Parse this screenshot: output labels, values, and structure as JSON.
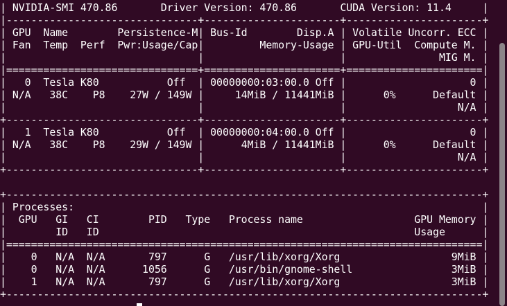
{
  "terminal": {
    "background": "#300a24",
    "foreground": "#ffffff",
    "lines": [
      "| NVIDIA-SMI 470.86       Driver Version: 470.86       CUDA Version: 11.4     |",
      "|-------------------------------+----------------------+----------------------+",
      "| GPU  Name        Persistence-M| Bus-Id        Disp.A | Volatile Uncorr. ECC |",
      "| Fan  Temp  Perf  Pwr:Usage/Cap|         Memory-Usage | GPU-Util  Compute M. |",
      "|                               |                      |               MIG M. |",
      "|===============================+======================+======================|",
      "|   0  Tesla K80           Off  | 00000000:03:00.0 Off |                    0 |",
      "| N/A   38C    P8    27W / 149W |     14MiB / 11441MiB |      0%      Default |",
      "|                               |                      |                  N/A |",
      "+-------------------------------+----------------------+----------------------+",
      "|   1  Tesla K80           Off  | 00000000:04:00.0 Off |                    0 |",
      "| N/A   38C    P8    29W / 149W |      4MiB / 11441MiB |      0%      Default |",
      "|                               |                      |                  N/A |",
      "+-------------------------------+----------------------+----------------------+",
      "                                                                               ",
      "+-----------------------------------------------------------------------------+",
      "| Processes:                                                                  |",
      "|  GPU   GI   CI        PID   Type   Process name                  GPU Memory |",
      "|        ID   ID                                                   Usage      |",
      "|=============================================================================|",
      "|    0   N/A  N/A       797      G   /usr/lib/xorg/Xorg                  9MiB |",
      "|    0   N/A  N/A      1056      G   /usr/bin/gnome-shell                3MiB |",
      "|    1   N/A  N/A       797      G   /usr/lib/xorg/Xorg                  3MiB |",
      "+-----------------------------------------------------------------------------+"
    ]
  },
  "scrollbar": {
    "thumb_color": "#8c8589",
    "thumb_start_fraction": 0.14,
    "thumb_end_fraction": 1.0
  }
}
